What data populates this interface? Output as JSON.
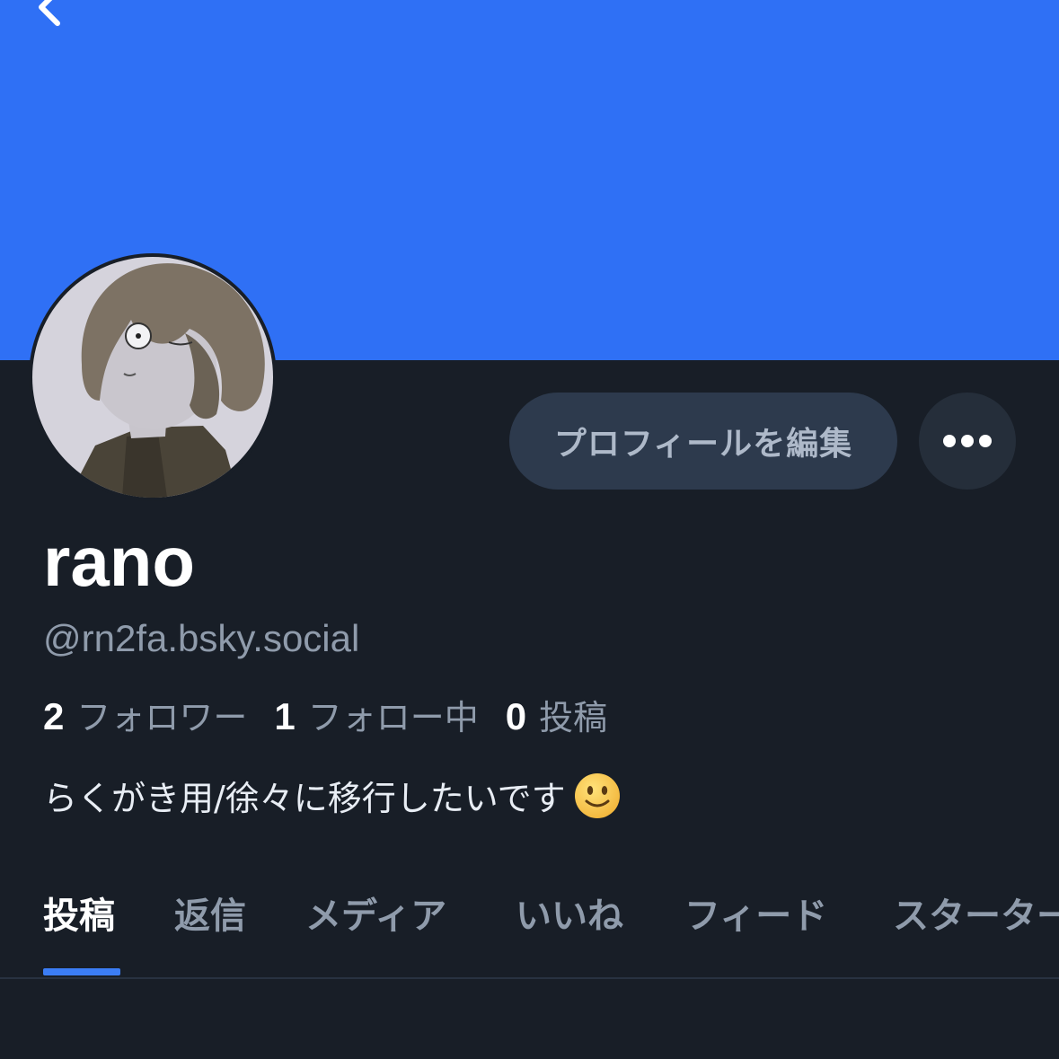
{
  "profile": {
    "display_name": "rano",
    "handle": "@rn2fa.bsky.social",
    "bio": "らくがき用/徐々に移行したいです",
    "bio_emoji": "slightly-smiling-face",
    "banner_color": "#2f70f5"
  },
  "actions": {
    "edit_profile_label": "プロフィールを編集",
    "more_icon": "ellipsis-icon",
    "back_icon": "chevron-left-icon"
  },
  "stats": [
    {
      "count": "2",
      "label": "フォロワー"
    },
    {
      "count": "1",
      "label": "フォロー中"
    },
    {
      "count": "0",
      "label": "投稿"
    }
  ],
  "tabs": [
    {
      "label": "投稿",
      "active": true
    },
    {
      "label": "返信",
      "active": false
    },
    {
      "label": "メディア",
      "active": false
    },
    {
      "label": "いいね",
      "active": false
    },
    {
      "label": "フィード",
      "active": false
    },
    {
      "label": "スターター",
      "active": false
    }
  ],
  "colors": {
    "background": "#181e27",
    "accent": "#3b7df5",
    "button_bg": "#2d3a4d",
    "muted_text": "#8f9bab"
  }
}
